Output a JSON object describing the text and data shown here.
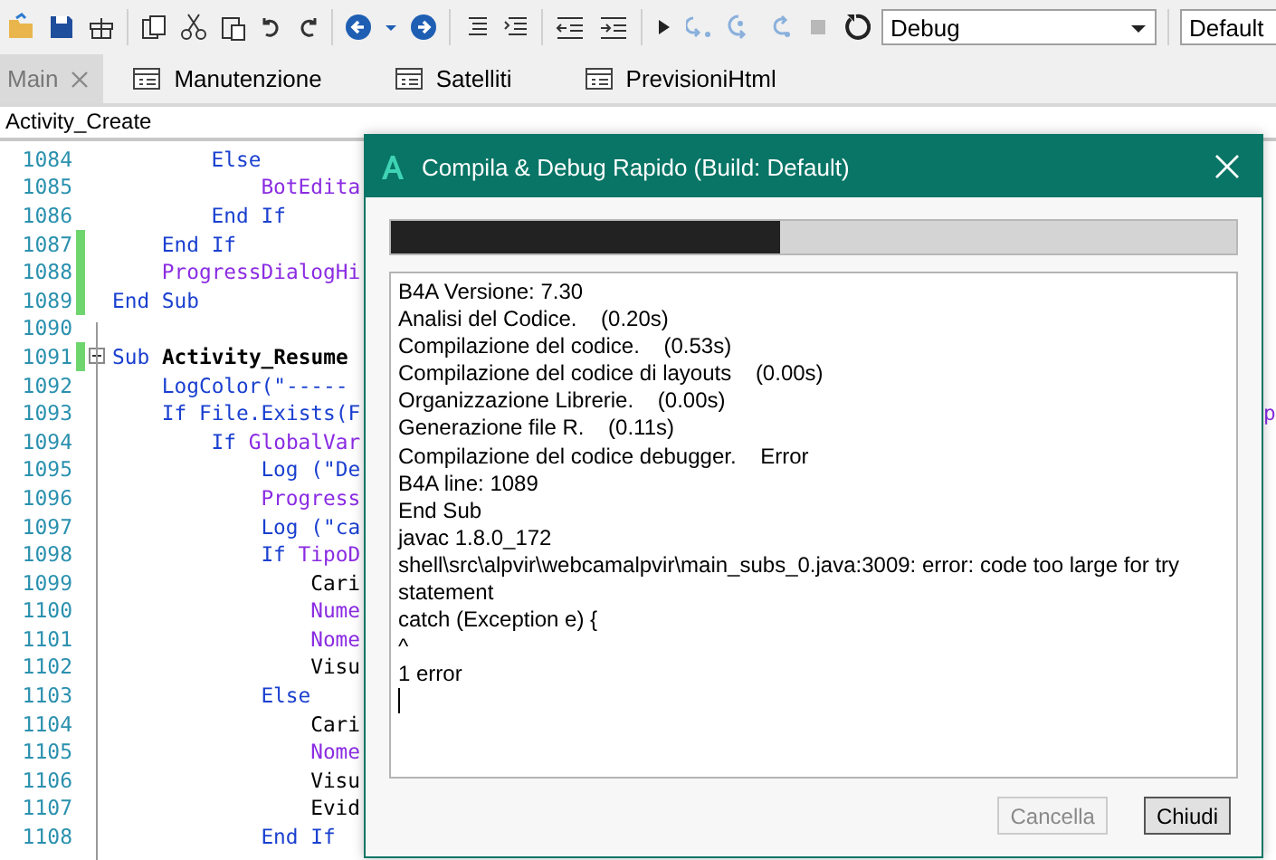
{
  "toolbar": {
    "configuration": "Debug",
    "build": "Default"
  },
  "tabs": [
    {
      "label": "Main",
      "selected": true
    },
    {
      "label": "Manutenzione",
      "selected": false
    },
    {
      "label": "Satelliti",
      "selected": false
    },
    {
      "label": "PrevisioniHtml",
      "selected": false
    }
  ],
  "breadcrumb": "Activity_Create",
  "editor": {
    "lines": [
      {
        "children": [
          {
            "children": [
              {
                "number": "1084",
                "changed": false,
                "fold": false,
                "tokens": [
                  {
                    "kind": "keyword",
                    "text": "Else"
                  }
                ],
                "children": [
                  {
                    "number": "1085",
                    "changed": false,
                    "fold": false,
                    "tokens": [
                      {
                        "kind": "ident",
                        "text": "BotEdita"
                      }
                    ]
                  }
                ]
              },
              {
                "number": "1086",
                "changed": false,
                "fold": false,
                "tokens": [
                  {
                    "kind": "keyword",
                    "text": "End If"
                  }
                ]
              }
            ]
          },
          {
            "number": "1087",
            "changed": true,
            "fold": false,
            "tokens": [
              {
                "kind": "keyword",
                "text": "End If"
              }
            ]
          },
          {
            "number": "1088",
            "changed": true,
            "fold": false,
            "tokens": [
              {
                "kind": "ident",
                "text": "ProgressDialogHi"
              }
            ]
          }
        ]
      },
      {
        "number": "1089",
        "changed": true,
        "fold": false,
        "tokens": [
          {
            "kind": "keyword",
            "text": "End Sub"
          }
        ]
      },
      {
        "number": "1090",
        "changed": false,
        "fold": false
      },
      {
        "number": "1091",
        "changed": true,
        "fold": true,
        "tokens": [
          {
            "kind": "keyword",
            "text": "Sub "
          },
          {
            "kind": "name",
            "text": "Activity_Resume"
          }
        ],
        "children": [
          {
            "number": "1092",
            "changed": false,
            "fold": false,
            "tokens": [
              {
                "kind": "keyword",
                "text": "LogColor(\"-----"
              }
            ]
          },
          {
            "number": "1093",
            "changed": false,
            "fold": false,
            "tokens": [
              {
                "kind": "keyword",
                "text": "If File.Exists(F"
              }
            ],
            "tail": "p",
            "children": [
              {
                "number": "1094",
                "changed": false,
                "fold": false,
                "tokens": [
                  {
                    "kind": "keyword",
                    "text": "If "
                  },
                  {
                    "kind": "ident",
                    "text": "GlobalVar"
                  }
                ],
                "children": [
                  {
                    "number": "1095",
                    "changed": false,
                    "fold": false,
                    "tokens": [
                      {
                        "kind": "keyword",
                        "text": "Log (\"De"
                      }
                    ]
                  },
                  {
                    "number": "1096",
                    "changed": false,
                    "fold": false,
                    "tokens": [
                      {
                        "kind": "ident",
                        "text": "Progress"
                      }
                    ]
                  },
                  {
                    "number": "1097",
                    "changed": false,
                    "fold": false,
                    "tokens": [
                      {
                        "kind": "keyword",
                        "text": "Log (\"ca"
                      }
                    ]
                  },
                  {
                    "number": "1098",
                    "changed": false,
                    "fold": false,
                    "tokens": [
                      {
                        "kind": "keyword",
                        "text": "If "
                      },
                      {
                        "kind": "ident",
                        "text": "TipoD"
                      }
                    ],
                    "children": [
                      {
                        "number": "1099",
                        "changed": false,
                        "fold": false,
                        "tokens": [
                          {
                            "kind": "plain",
                            "text": "Cari"
                          }
                        ]
                      },
                      {
                        "number": "1100",
                        "changed": false,
                        "fold": false,
                        "tokens": [
                          {
                            "kind": "ident",
                            "text": "Nume"
                          }
                        ]
                      },
                      {
                        "number": "1101",
                        "changed": false,
                        "fold": false,
                        "tokens": [
                          {
                            "kind": "ident",
                            "text": "Nome"
                          }
                        ]
                      },
                      {
                        "number": "1102",
                        "changed": false,
                        "fold": false,
                        "tokens": [
                          {
                            "kind": "plain",
                            "text": "Visu"
                          }
                        ]
                      }
                    ]
                  },
                  {
                    "number": "1103",
                    "changed": false,
                    "fold": false,
                    "tokens": [
                      {
                        "kind": "keyword",
                        "text": "Else"
                      }
                    ],
                    "children": [
                      {
                        "number": "1104",
                        "changed": false,
                        "fold": false,
                        "tokens": [
                          {
                            "kind": "plain",
                            "text": "Cari"
                          }
                        ]
                      },
                      {
                        "number": "1105",
                        "changed": false,
                        "fold": false,
                        "tokens": [
                          {
                            "kind": "ident",
                            "text": "Nome"
                          }
                        ]
                      },
                      {
                        "number": "1106",
                        "changed": false,
                        "fold": false,
                        "tokens": [
                          {
                            "kind": "plain",
                            "text": "Visu"
                          }
                        ]
                      },
                      {
                        "number": "1107",
                        "changed": false,
                        "fold": false,
                        "tokens": [
                          {
                            "kind": "plain",
                            "text": "Evid"
                          }
                        ]
                      }
                    ]
                  },
                  {
                    "number": "1108",
                    "changed": false,
                    "fold": false,
                    "tokens": [
                      {
                        "kind": "keyword",
                        "text": "End If"
                      }
                    ]
                  }
                ]
              }
            ]
          }
        ]
      }
    ]
  },
  "dialog": {
    "title": "Compila & Debug Rapido (Build: Default)",
    "progress": {
      "level": 0.46
    },
    "log": [
      "B4A Versione: 7.30",
      "Analisi del Codice.    (0.20s)",
      "Compilazione del codice.    (0.53s)",
      "Compilazione del codice di layouts    (0.00s)",
      "Organizzazione Librerie.    (0.00s)",
      "Generazione file R.    (0.11s)",
      "Compilazione del codice debugger.    Error",
      "B4A line: 1089",
      "End Sub",
      "javac 1.8.0_172",
      "shell\\src\\alpvir\\webcamalpvir\\main_subs_0.java:3009: error: code too large for try statement",
      "catch (Exception e) {",
      "^",
      "1 error"
    ],
    "buttons": [
      {
        "label": "Cancella",
        "disabled": true
      },
      {
        "label": "Chiudi",
        "disabled": false
      }
    ]
  }
}
